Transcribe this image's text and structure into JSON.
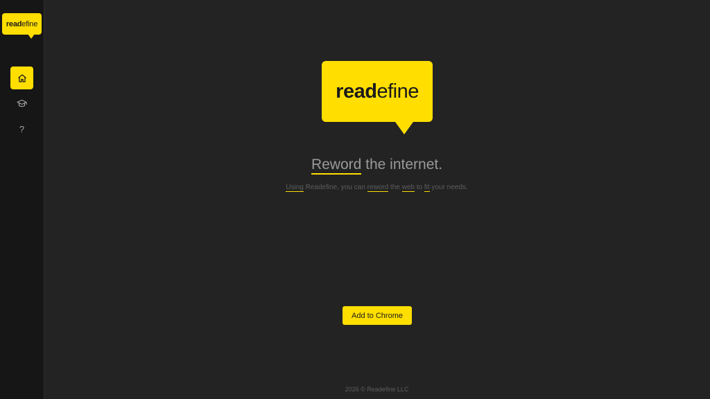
{
  "brand": {
    "part_bold": "read",
    "part_regular": "efine"
  },
  "sidebar": {
    "items": [
      {
        "id": "home",
        "icon": "home-icon",
        "active": true
      },
      {
        "id": "learn",
        "icon": "graduation-cap-icon",
        "active": false
      },
      {
        "id": "help",
        "icon": "question-mark-icon",
        "glyph": "?",
        "active": false
      }
    ]
  },
  "hero": {
    "headline_word": "Reword",
    "headline_rest": " the internet.",
    "sub": {
      "w1": "Using",
      "t1": " Readefine, you can ",
      "w2": "reword",
      "t2": " the ",
      "w3": "web",
      "t3": " to ",
      "w4": "fit",
      "t4": " your needs."
    },
    "cta_label": "Add to Chrome"
  },
  "footer": {
    "text": "2026 © Readefine LLC"
  },
  "colors": {
    "accent": "#ffde00",
    "background": "#232323",
    "sidebar": "#161616"
  }
}
